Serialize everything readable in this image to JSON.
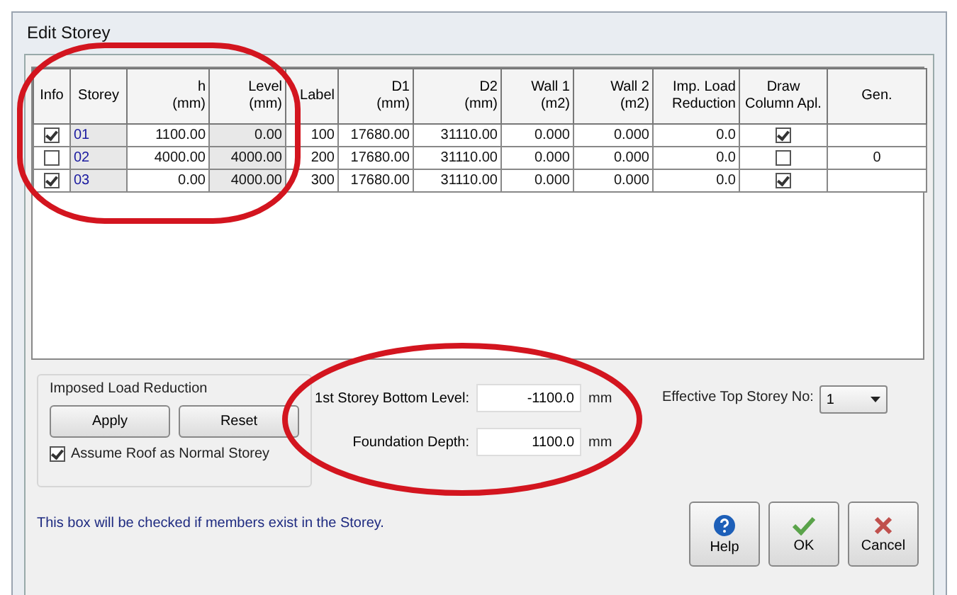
{
  "window": {
    "title": "Edit Storey"
  },
  "table": {
    "columns": [
      {
        "label": "Info"
      },
      {
        "label": "Storey"
      },
      {
        "label": "h",
        "unit": "(mm)"
      },
      {
        "label": "Level",
        "unit": "(mm)"
      },
      {
        "label": "Label"
      },
      {
        "label": "D1",
        "unit": "(mm)"
      },
      {
        "label": "D2",
        "unit": "(mm)"
      },
      {
        "label": "Wall 1",
        "unit": "(m2)"
      },
      {
        "label": "Wall 2",
        "unit": "(m2)"
      },
      {
        "label": "Imp. Load",
        "unit": "Reduction"
      },
      {
        "label": "Draw",
        "unit": "Column Apl."
      },
      {
        "label": "Gen."
      }
    ],
    "rows": [
      {
        "info": true,
        "storey": "01",
        "h": "1100.00",
        "level": "0.00",
        "label": "100",
        "d1": "17680.00",
        "d2": "31110.00",
        "wall1": "0.000",
        "wall2": "0.000",
        "imp": "0.0",
        "draw": true
      },
      {
        "info": false,
        "storey": "02",
        "h": "4000.00",
        "level": "4000.00",
        "label": "200",
        "d1": "17680.00",
        "d2": "31110.00",
        "wall1": "0.000",
        "wall2": "0.000",
        "imp": "0.0",
        "draw": false,
        "gen": "0"
      },
      {
        "info": true,
        "storey": "03",
        "h": "0.00",
        "level": "4000.00",
        "label": "300",
        "d1": "17680.00",
        "d2": "31110.00",
        "wall1": "0.000",
        "wall2": "0.000",
        "imp": "0.0",
        "draw": true
      }
    ]
  },
  "imposed_load_reduction": {
    "title": "Imposed Load Reduction",
    "buttons": [
      "Apply",
      "Reset"
    ],
    "assume_roof": {
      "label": "Assume Roof as Normal Storey",
      "checked": true
    }
  },
  "fields": [
    {
      "label": "1st Storey Bottom Level:",
      "value": "-1100.0",
      "unit": "mm"
    },
    {
      "label": "Foundation Depth:",
      "value": "1100.0",
      "unit": "mm"
    }
  ],
  "effective_top": {
    "label": "Effective Top Storey No:",
    "value": "1"
  },
  "hint": "This box will be checked if members exist in the Storey.",
  "buttons": [
    {
      "kind": "help",
      "label": "Help"
    },
    {
      "kind": "ok",
      "label": "OK"
    },
    {
      "kind": "cancel",
      "label": "Cancel"
    }
  ]
}
